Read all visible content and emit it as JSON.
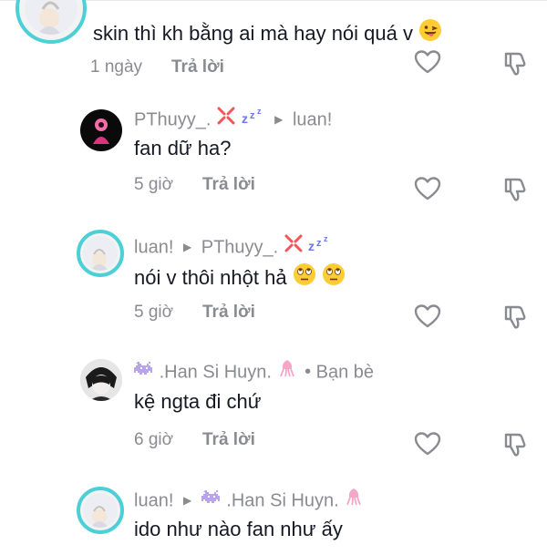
{
  "comments": [
    {
      "text": "skin thì kh bằng ai mà hay nói quá v",
      "time": "1 ngày",
      "reply": "Trả lời"
    },
    {
      "username": "PThuyy_.",
      "reply_to": "luan!",
      "text": "fan dữ ha?",
      "time": "5 giờ",
      "reply": "Trả lời"
    },
    {
      "username": "luan!",
      "reply_to": "PThuyy_.",
      "text": "nói v thôi nhột hả",
      "time": "5 giờ",
      "reply": "Trả lời"
    },
    {
      "username": ".Han Si Huyn.",
      "badge": "Bạn bè",
      "text": "kệ ngta đi chứ",
      "time": "6 giờ",
      "reply": "Trả lời"
    },
    {
      "username": "luan!",
      "reply_to": ".Han Si Huyn.",
      "text": "ido như nào fan như ấy"
    }
  ],
  "icons": {
    "like": "heart-outline-icon",
    "dislike": "thumbs-down-outline-icon",
    "arrow": "right-triangle-icon"
  },
  "colors": {
    "avatar_ring": "#4ccfd6",
    "secondary_text": "#8a8b91",
    "primary_text": "#161823"
  }
}
